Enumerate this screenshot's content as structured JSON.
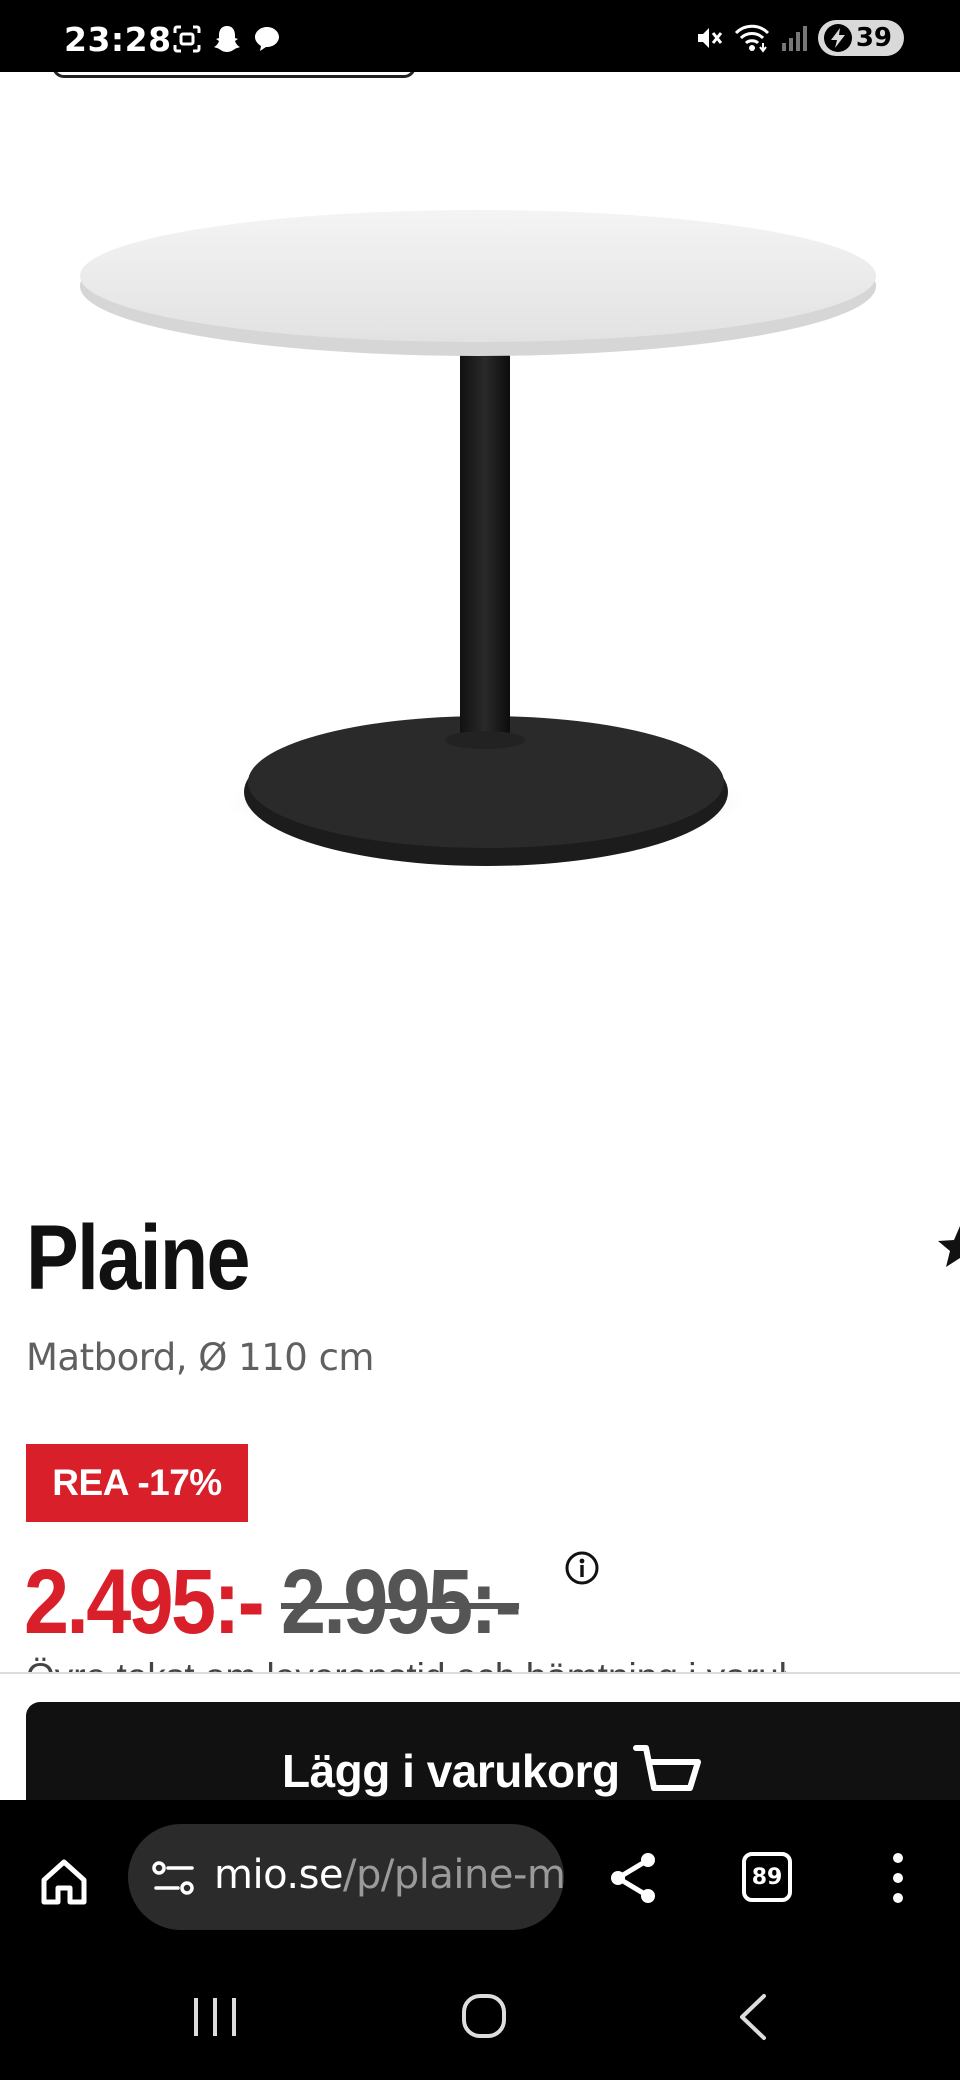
{
  "status_bar": {
    "time": "23:28",
    "battery": "39",
    "icons_left": [
      "screenshot-icon",
      "snapchat-icon",
      "chat-icon"
    ],
    "icons_right": [
      "mute-icon",
      "wifi-icon",
      "signal-icon",
      "battery-charging-icon"
    ]
  },
  "product": {
    "image_icon": "round-pedestal-table-white-top-black-base",
    "name": "Plaine",
    "subtitle": "Matbord, Ø 110 cm",
    "sale_badge": "REA -17%",
    "price_current": "2.495:-",
    "price_old": "2.995:-",
    "info_icon": "info-icon",
    "wishlist_icon": "star-icon",
    "delivery_text": "Övre tekst om leveranstid och hämtning i varuhus"
  },
  "cta": {
    "add_to_cart": "Lägg i varukorg",
    "cart_icon": "shopping-basket-icon"
  },
  "browser": {
    "url_domain": "mio.se",
    "url_path": "/p/plaine-matbord",
    "tab_count": "89",
    "icons": [
      "home-icon",
      "site-settings-icon",
      "share-icon",
      "tabs-icon",
      "more-vertical-icon"
    ]
  },
  "nav": {
    "icons": [
      "recent-apps-icon",
      "home-circle-icon",
      "back-icon"
    ]
  },
  "colors": {
    "sale_red": "#d81f2a",
    "button_black": "#111111",
    "text_dark": "#111111",
    "text_muted": "#606060",
    "url_pill": "#2b2b2b"
  }
}
